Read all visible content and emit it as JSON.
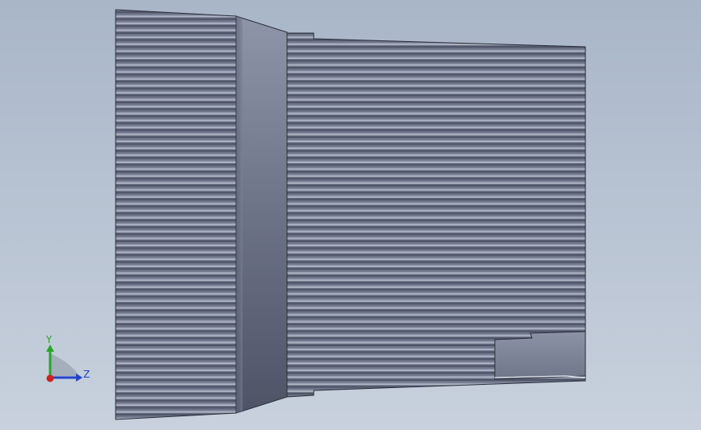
{
  "viewport": {
    "background_top": "#a9b6c8",
    "background_bottom": "#c8d1dd",
    "part_color": "#6f7588",
    "groove_dark": "#4f5568",
    "groove_light": "#9aa2b6"
  },
  "triad": {
    "y_label": "Y",
    "z_label": "Z",
    "y_color": "#2aa52a",
    "z_color": "#2244cc",
    "x_color": "#cc2222"
  }
}
